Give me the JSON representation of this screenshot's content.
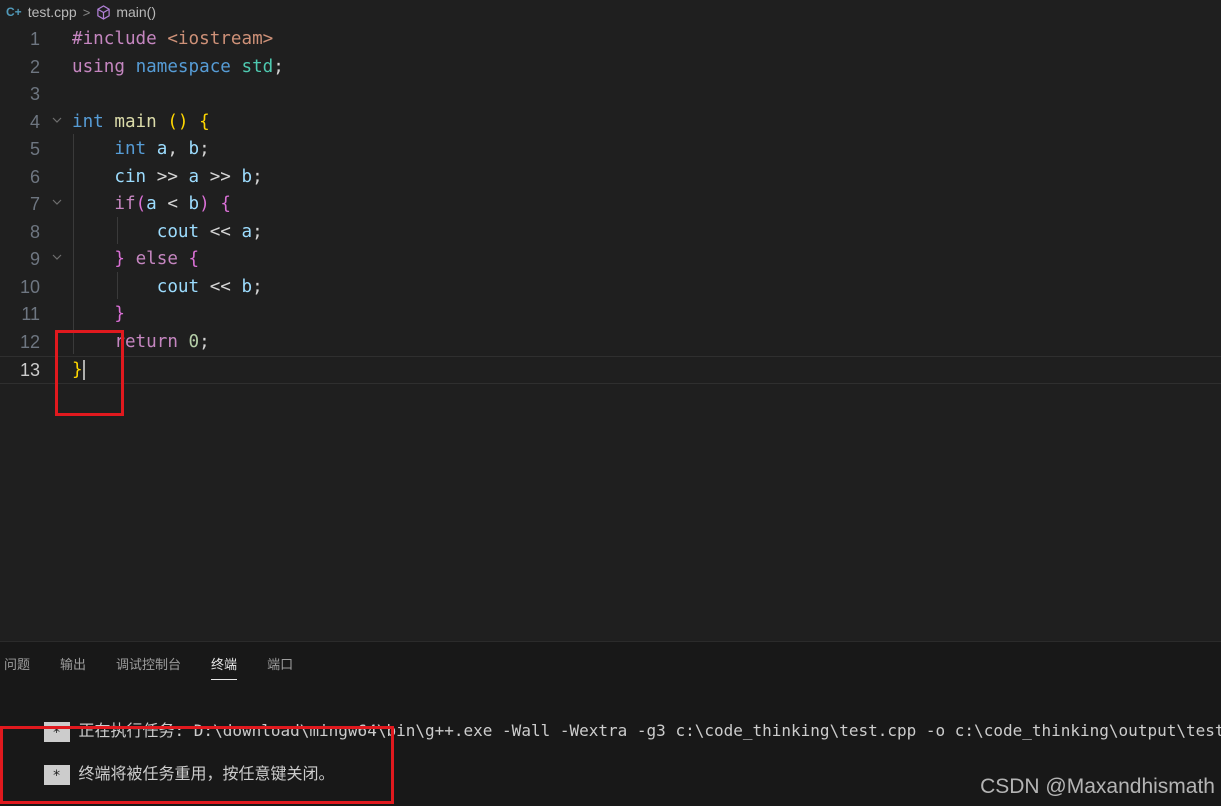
{
  "breadcrumb": {
    "file_icon": "cpp-file-icon",
    "file": "test.cpp",
    "separator": ">",
    "symbol_icon": "cube-icon",
    "symbol": "main()"
  },
  "editor": {
    "line_numbers": [
      "1",
      "2",
      "3",
      "4",
      "5",
      "6",
      "7",
      "8",
      "9",
      "10",
      "11",
      "12",
      "13"
    ],
    "active_line": 13,
    "lines": [
      [
        [
          "#include ",
          "kw-pink"
        ],
        [
          "<iostream>",
          "str"
        ]
      ],
      [
        [
          "using ",
          "kw-pink"
        ],
        [
          "namespace ",
          "kw-blue"
        ],
        [
          "std",
          "ty"
        ],
        [
          ";",
          "tx"
        ]
      ],
      [],
      [
        [
          "int ",
          "kw-blue"
        ],
        [
          "main ",
          "fn"
        ],
        [
          "() ",
          "br1"
        ],
        [
          "{",
          "br1"
        ]
      ],
      [
        [
          "    "
        ],
        [
          "int ",
          "kw-blue"
        ],
        [
          "a",
          "var"
        ],
        [
          ", ",
          "tx"
        ],
        [
          "b",
          "var"
        ],
        [
          ";",
          "tx"
        ]
      ],
      [
        [
          "    "
        ],
        [
          "cin ",
          "var"
        ],
        [
          ">> ",
          "tx"
        ],
        [
          "a ",
          "var"
        ],
        [
          ">> ",
          "tx"
        ],
        [
          "b",
          "var"
        ],
        [
          ";",
          "tx"
        ]
      ],
      [
        [
          "    "
        ],
        [
          "if",
          "kw-pink"
        ],
        [
          "(",
          "br2"
        ],
        [
          "a ",
          "var"
        ],
        [
          "< ",
          "tx"
        ],
        [
          "b",
          "var"
        ],
        [
          ") ",
          "br2"
        ],
        [
          "{",
          "br2"
        ]
      ],
      [
        [
          "        "
        ],
        [
          "cout ",
          "var"
        ],
        [
          "<< ",
          "tx"
        ],
        [
          "a",
          "var"
        ],
        [
          ";",
          "tx"
        ]
      ],
      [
        [
          "    "
        ],
        [
          "} ",
          "br2"
        ],
        [
          "else ",
          "kw-pink"
        ],
        [
          "{",
          "br2"
        ]
      ],
      [
        [
          "        "
        ],
        [
          "cout ",
          "var"
        ],
        [
          "<< ",
          "tx"
        ],
        [
          "b",
          "var"
        ],
        [
          ";",
          "tx"
        ]
      ],
      [
        [
          "    "
        ],
        [
          "}",
          "br2"
        ]
      ],
      [
        [
          "    "
        ],
        [
          "return ",
          "kw-pink"
        ],
        [
          "0",
          "num"
        ],
        [
          ";",
          "tx"
        ]
      ],
      [
        [
          "}",
          "br1"
        ]
      ]
    ]
  },
  "panel": {
    "tabs": [
      "问题",
      "输出",
      "调试控制台",
      "终端",
      "端口"
    ],
    "active_tab": "终端",
    "terminal": [
      {
        "marker": "*",
        "text": "正在执行任务: D:\\download\\mingw64\\bin\\g++.exe -Wall -Wextra -g3 c:\\code_thinking\\test.cpp -o c:\\code_thinking\\output\\test.exe"
      },
      {
        "marker": "*",
        "text": "终端将被任务重用，按任意键关闭。"
      }
    ]
  },
  "annotation_color": "#e0191e",
  "watermark": "CSDN @Maxandhismath"
}
